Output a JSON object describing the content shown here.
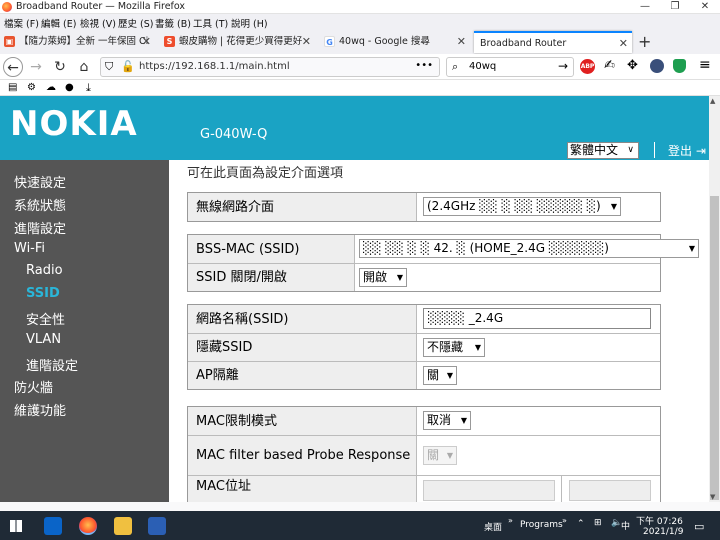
{
  "window": {
    "title": "Broadband Router — Mozilla Firefox",
    "minimize": "—",
    "restore": "❐",
    "close": "✕"
  },
  "menu": [
    "檔案 (F)",
    "編輯 (E)",
    "檢視 (V)",
    "歷史 (S)",
    "書籤 (B)",
    "工具 (T)",
    "說明 (H)"
  ],
  "tabs": [
    {
      "label": "【隨力萊姆】全新 一年保固 Ci",
      "icon": "shop-icon"
    },
    {
      "label": "蝦皮購物 | 花得更少買得更好",
      "icon": "shopee-icon"
    },
    {
      "label": "40wq - Google 搜尋",
      "icon": "google-icon"
    },
    {
      "label": "Broadband Router",
      "icon": "router-icon"
    }
  ],
  "nav": {
    "url": "https://192.168.1.1/main.html",
    "search": "40wq",
    "more": "•••"
  },
  "brand": {
    "logo": "NOKIA",
    "model": "G-040W-Q",
    "language": "繁體中文",
    "logout": "登出",
    "header_color": "#1aa3c4",
    "accent": "#2ab6d9"
  },
  "sidebar": [
    {
      "label": "快速設定",
      "level": 0,
      "selected": false
    },
    {
      "label": "系統狀態",
      "level": 0,
      "selected": false
    },
    {
      "label": "進階設定",
      "level": 0,
      "selected": false
    },
    {
      "label": "Wi-Fi",
      "level": 0,
      "selected": false
    },
    {
      "label": "Radio",
      "level": 1,
      "selected": false
    },
    {
      "label": "SSID",
      "level": 1,
      "selected": true
    },
    {
      "label": "安全性",
      "level": 1,
      "selected": false
    },
    {
      "label": "VLAN",
      "level": 1,
      "selected": false
    },
    {
      "label": "進階設定",
      "level": 1,
      "selected": false
    },
    {
      "label": "防火牆",
      "level": 0,
      "selected": false
    },
    {
      "label": "維護功能",
      "level": 0,
      "selected": false
    }
  ],
  "content": {
    "intro": "可在此頁面為設定介面選項",
    "wireless_interface": {
      "label": "無線網路介面",
      "value": "(2.4GHz ░░ ░ ░░ ░░░░░ ░)"
    },
    "bss_mac": {
      "label": "BSS-MAC (SSID)",
      "value": "░░ ░░ ░ ░ 42. ░ (HOME_2.4G ░░░░░░)"
    },
    "ssid_toggle": {
      "label": "SSID 關閉/開啟",
      "value": "開啟"
    },
    "ssid_name": {
      "label": "網路名稱(SSID)",
      "value": "░░░░ _2.4G"
    },
    "hide_ssid": {
      "label": "隱藏SSID",
      "value": "不隱藏"
    },
    "ap_isolation": {
      "label": "AP隔離",
      "value": "關"
    },
    "mac_limit": {
      "label": "MAC限制模式",
      "value": "取消"
    },
    "mac_probe": {
      "label": "MAC filter based Probe Response",
      "value": "關"
    },
    "mac_addr": {
      "label": "MAC位址",
      "value1": "",
      "value2": ""
    }
  },
  "taskbar": {
    "desktop": "桌面",
    "programs": "Programs",
    "time": "下午 07:26",
    "date": "2021/1/9",
    "ime": "中"
  }
}
